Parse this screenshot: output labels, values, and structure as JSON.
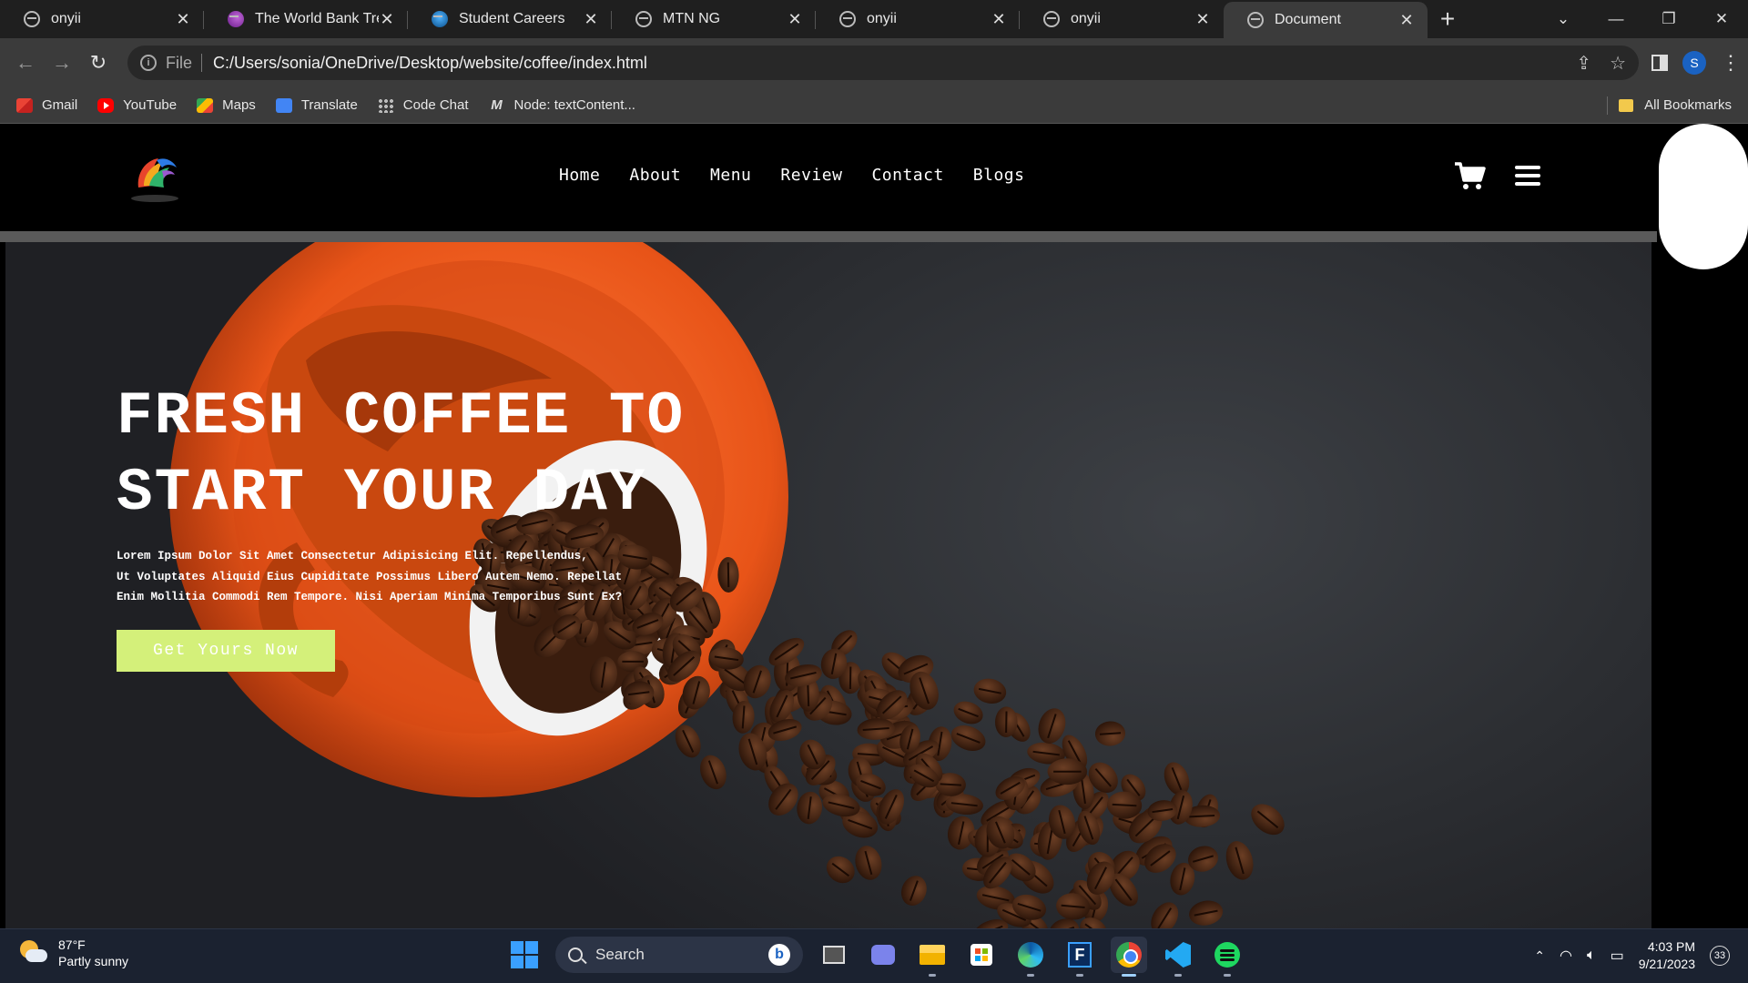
{
  "browser": {
    "tabs": [
      {
        "title": "onyii",
        "favicon": "globe-icon"
      },
      {
        "title": "The World Bank Treas",
        "favicon": "worldbank-icon"
      },
      {
        "title": "Student Careers",
        "favicon": "careers-icon"
      },
      {
        "title": "MTN NG",
        "favicon": "globe-icon"
      },
      {
        "title": "onyii",
        "favicon": "globe-icon"
      },
      {
        "title": "onyii",
        "favicon": "globe-icon"
      },
      {
        "title": "Document",
        "favicon": "globe-icon",
        "active": true
      }
    ],
    "omnibox": {
      "scheme_label": "File",
      "url": "C:/Users/sonia/OneDrive/Desktop/website/coffee/index.html"
    },
    "profile_initial": "S",
    "bookmarks": [
      {
        "label": "Gmail",
        "icon": "gmail-icon"
      },
      {
        "label": "YouTube",
        "icon": "youtube-icon"
      },
      {
        "label": "Maps",
        "icon": "maps-icon"
      },
      {
        "label": "Translate",
        "icon": "translate-icon"
      },
      {
        "label": "Code Chat",
        "icon": "code-chat-icon"
      },
      {
        "label": "Node: textContent...",
        "icon": "node-icon",
        "glyph": "M"
      }
    ],
    "all_bookmarks_label": "All Bookmarks"
  },
  "site": {
    "nav": [
      "Home",
      "About",
      "Menu",
      "Review",
      "Contact",
      "Blogs"
    ],
    "hero": {
      "title_line1": "FRESH COFFEE TO",
      "title_line2": "START YOUR DAY",
      "text_line1": "Lorem Ipsum Dolor Sit Amet Consectetur Adipisicing Elit. Repellendus,",
      "text_line2": "Ut Voluptates Aliquid Eius Cupiditate Possimus Libero Autem Nemo. Repellat",
      "text_line3": "Enim Mollitia Commodi Rem Tempore. Nisi Aperiam Minima Temporibus Sunt Ex?",
      "button_label": "Get Yours Now",
      "button_color": "#d4f07a"
    }
  },
  "taskbar": {
    "weather_temp": "87°F",
    "weather_desc": "Partly sunny",
    "search_label": "Search",
    "bing_label": "b",
    "f_app_label": "F",
    "time": "4:03 PM",
    "date": "9/21/2023",
    "notification_count": "33"
  }
}
